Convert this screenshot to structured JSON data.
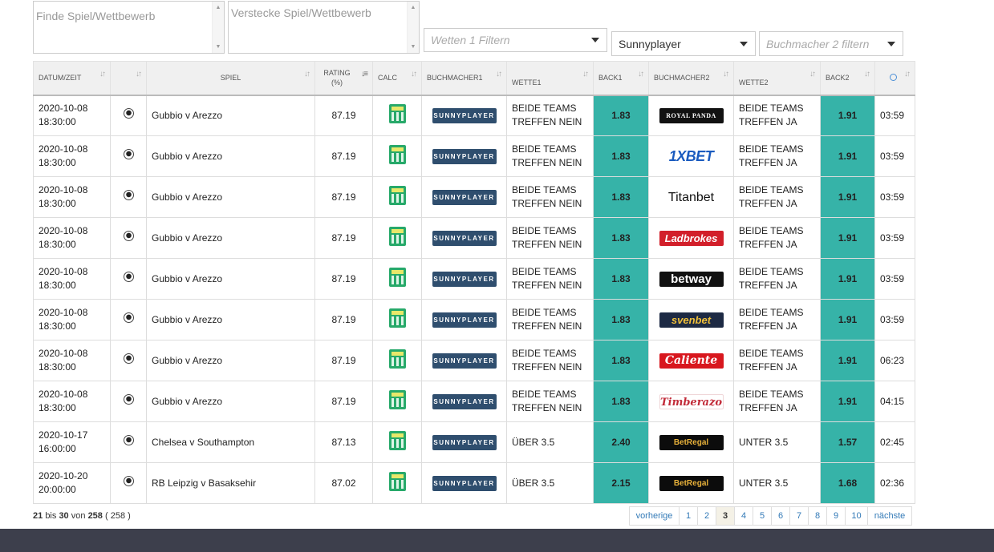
{
  "filters": {
    "search_placeholder": "Finde Spiel/Wettbewerb",
    "hide_placeholder": "Verstecke Spiel/Wettbewerb",
    "wette_filter_placeholder": "Wetten 1 Filtern",
    "bookmaker1_selected": "Sunnyplayer",
    "bookmaker2_placeholder": "Buchmacher 2 filtern"
  },
  "columns": [
    "DATUM/ZEIT",
    "",
    "SPIEL",
    "RATING (%)",
    "CALC",
    "BUCHMACHER1",
    "WETTE1",
    "BACK1",
    "BUCHMACHER2",
    "WETTE2",
    "BACK2",
    ""
  ],
  "rows": [
    {
      "date": "2020-10-08",
      "time": "18:30:00",
      "match": "Gubbio v Arezzo",
      "rating": "87.19",
      "bm1": "SUNNYPLAYER",
      "bet1a": "BEIDE TEAMS",
      "bet1b": "TREFFEN NEIN",
      "back1": "1.83",
      "bm2": "ROYAL PANDA",
      "bm2_style": "royal",
      "bet2a": "BEIDE TEAMS",
      "bet2b": "TREFFEN JA",
      "back2": "1.91",
      "age": "03:59"
    },
    {
      "date": "2020-10-08",
      "time": "18:30:00",
      "match": "Gubbio v Arezzo",
      "rating": "87.19",
      "bm1": "SUNNYPLAYER",
      "bet1a": "BEIDE TEAMS",
      "bet1b": "TREFFEN NEIN",
      "back1": "1.83",
      "bm2": "1XBET",
      "bm2_style": "1x",
      "bet2a": "BEIDE TEAMS",
      "bet2b": "TREFFEN JA",
      "back2": "1.91",
      "age": "03:59"
    },
    {
      "date": "2020-10-08",
      "time": "18:30:00",
      "match": "Gubbio v Arezzo",
      "rating": "87.19",
      "bm1": "SUNNYPLAYER",
      "bet1a": "BEIDE TEAMS",
      "bet1b": "TREFFEN NEIN",
      "back1": "1.83",
      "bm2": "Titanbet",
      "bm2_style": "titan",
      "bet2a": "BEIDE TEAMS",
      "bet2b": "TREFFEN JA",
      "back2": "1.91",
      "age": "03:59"
    },
    {
      "date": "2020-10-08",
      "time": "18:30:00",
      "match": "Gubbio v Arezzo",
      "rating": "87.19",
      "bm1": "SUNNYPLAYER",
      "bet1a": "BEIDE TEAMS",
      "bet1b": "TREFFEN NEIN",
      "back1": "1.83",
      "bm2": "Ladbrokes",
      "bm2_style": "lad",
      "bet2a": "BEIDE TEAMS",
      "bet2b": "TREFFEN JA",
      "back2": "1.91",
      "age": "03:59"
    },
    {
      "date": "2020-10-08",
      "time": "18:30:00",
      "match": "Gubbio v Arezzo",
      "rating": "87.19",
      "bm1": "SUNNYPLAYER",
      "bet1a": "BEIDE TEAMS",
      "bet1b": "TREFFEN NEIN",
      "back1": "1.83",
      "bm2": "betway",
      "bm2_style": "betway",
      "bet2a": "BEIDE TEAMS",
      "bet2b": "TREFFEN JA",
      "back2": "1.91",
      "age": "03:59"
    },
    {
      "date": "2020-10-08",
      "time": "18:30:00",
      "match": "Gubbio v Arezzo",
      "rating": "87.19",
      "bm1": "SUNNYPLAYER",
      "bet1a": "BEIDE TEAMS",
      "bet1b": "TREFFEN NEIN",
      "back1": "1.83",
      "bm2": "svenbet",
      "bm2_style": "sven",
      "bet2a": "BEIDE TEAMS",
      "bet2b": "TREFFEN JA",
      "back2": "1.91",
      "age": "03:59"
    },
    {
      "date": "2020-10-08",
      "time": "18:30:00",
      "match": "Gubbio v Arezzo",
      "rating": "87.19",
      "bm1": "SUNNYPLAYER",
      "bet1a": "BEIDE TEAMS",
      "bet1b": "TREFFEN NEIN",
      "back1": "1.83",
      "bm2": "Caliente",
      "bm2_style": "cal",
      "bet2a": "BEIDE TEAMS",
      "bet2b": "TREFFEN JA",
      "back2": "1.91",
      "age": "06:23"
    },
    {
      "date": "2020-10-08",
      "time": "18:30:00",
      "match": "Gubbio v Arezzo",
      "rating": "87.19",
      "bm1": "SUNNYPLAYER",
      "bet1a": "BEIDE TEAMS",
      "bet1b": "TREFFEN NEIN",
      "back1": "1.83",
      "bm2": "Timberazo",
      "bm2_style": "timb",
      "bet2a": "BEIDE TEAMS",
      "bet2b": "TREFFEN JA",
      "back2": "1.91",
      "age": "04:15"
    },
    {
      "date": "2020-10-17",
      "time": "16:00:00",
      "match": "Chelsea v Southampton",
      "rating": "87.13",
      "bm1": "SUNNYPLAYER",
      "bet1a": "ÜBER 3.5",
      "bet1b": "",
      "back1": "2.40",
      "bm2": "BetRegal",
      "bm2_style": "regal",
      "bet2a": "UNTER 3.5",
      "bet2b": "",
      "back2": "1.57",
      "age": "02:45"
    },
    {
      "date": "2020-10-20",
      "time": "20:00:00",
      "match": "RB Leipzig v Basaksehir",
      "rating": "87.02",
      "bm1": "SUNNYPLAYER",
      "bet1a": "ÜBER 3.5",
      "bet1b": "",
      "back1": "2.15",
      "bm2": "BetRegal",
      "bm2_style": "regal",
      "bet2a": "UNTER 3.5",
      "bet2b": "",
      "back2": "1.68",
      "age": "02:36"
    }
  ],
  "info": {
    "from": "21",
    "bis": "bis",
    "to": "30",
    "von": "von",
    "total": "258",
    "filtered": "( 258 )"
  },
  "pagination": {
    "prev": "vorherige",
    "pages": [
      "1",
      "2",
      "3",
      "4",
      "5",
      "6",
      "7",
      "8",
      "9",
      "10"
    ],
    "active": "3",
    "next": "nächste"
  },
  "colors": {
    "back_cell": "#36b3a8",
    "footer": "#3d3f4c",
    "sunnyplayer": "#2f4e6e"
  },
  "icons": {
    "sport": "soccer-ball-icon",
    "calc": "calculator-icon",
    "updated": "clock-icon",
    "sort": "sort-arrows-icon"
  }
}
